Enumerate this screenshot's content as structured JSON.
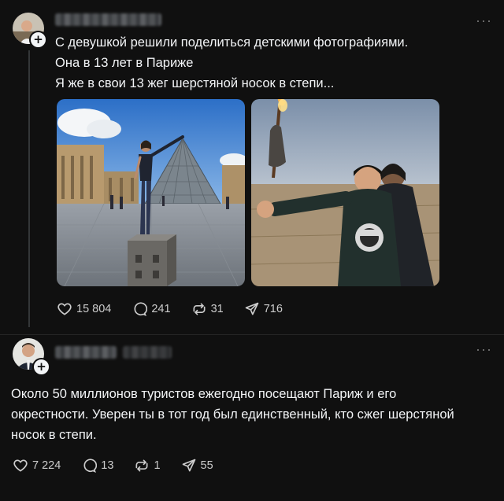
{
  "post1": {
    "text_lines": [
      "С девушкой решили поделиться детскими фотографиями.",
      "Она в 13 лет в Париже",
      "Я же в свои 13 жег шерстяной носок в степи..."
    ],
    "stats": {
      "likes": "15 804",
      "replies": "241",
      "reposts": "31",
      "shares": "716"
    },
    "photos": [
      "louvre-photo",
      "steppe-photo"
    ]
  },
  "post2": {
    "text_lines": [
      "Около 50 миллионов туристов ежегодно посещают Париж и его",
      "окрестности. Уверен ты в тот год был единственный, кто сжег шерстяной",
      "носок в степи."
    ],
    "stats": {
      "likes": "7 224",
      "replies": "13",
      "reposts": "1",
      "shares": "55"
    }
  },
  "icons": {
    "like": "heart-icon",
    "reply": "comment-icon",
    "repost": "repost-icon",
    "share": "share-icon",
    "more": "more-options-icon",
    "follow": "follow-plus-icon"
  },
  "colors": {
    "background": "#101010",
    "text": "#f3f5f7",
    "muted": "#cccccc"
  }
}
